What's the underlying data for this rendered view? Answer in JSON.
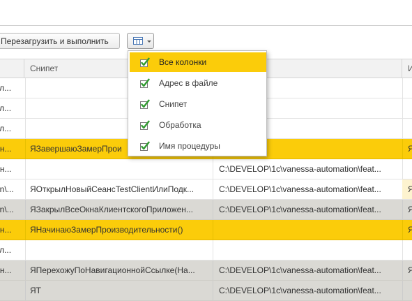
{
  "toolbar": {
    "reload_label": "Перезагрузить и выполнить",
    "columns_button_icon": "grid-icon"
  },
  "table": {
    "headers": [
      "Снипет",
      "И"
    ],
    "rows": [
      {
        "c1": "вл...",
        "snippet": "",
        "path": "",
        "c4": "",
        "style": "normal"
      },
      {
        "c1": "вл...",
        "snippet": "",
        "path": "",
        "c4": "",
        "style": "normal"
      },
      {
        "c1": "вл...",
        "snippet": "",
        "path": "",
        "c4": "",
        "style": "normal"
      },
      {
        "c1": "бн...",
        "snippet": "ЯЗавершаюЗамерПрои",
        "path": "",
        "c4": "Я",
        "style": "hl"
      },
      {
        "c1": "бн...",
        "snippet": "",
        "path": "C:\\DEVELOP\\1c\\vanessa-automation\\feat...",
        "c4": "",
        "style": "normal"
      },
      {
        "c1": "on\\...",
        "snippet": "ЯОткрылНовыйСеансTestClientИлиПодк...",
        "path": "C:\\DEVELOP\\1c\\vanessa-automation\\feat...",
        "c4": "Я",
        "style": "normal"
      },
      {
        "c1": "on\\...",
        "snippet": "ЯЗакрылВсеОкнаКлиентскогоПриложен...",
        "path": "C:\\DEVELOP\\1c\\vanessa-automation\\feat...",
        "c4": "Я",
        "style": "gray"
      },
      {
        "c1": "бн...",
        "snippet": "ЯНачинаюЗамерПроизводительности()",
        "path": "",
        "c4": "Я",
        "style": "hl"
      },
      {
        "c1": "вл...",
        "snippet": "",
        "path": "",
        "c4": "",
        "style": "normal"
      },
      {
        "c1": "бн...",
        "snippet": "ЯПерехожуПоНавигационнойСсылке(На...",
        "path": "C:\\DEVELOP\\1c\\vanessa-automation\\feat...",
        "c4": "Я",
        "style": "gray"
      },
      {
        "c1": "",
        "snippet": "ЯТ",
        "path": "C:\\DEVELOP\\1c\\vanessa-automation\\feat...",
        "c4": "",
        "style": "gray"
      }
    ]
  },
  "columns_menu": {
    "items": [
      {
        "label": "Все колонки",
        "checked": true,
        "active": true
      },
      {
        "label": "Адрес в файле",
        "checked": true,
        "active": false
      },
      {
        "label": "Снипет",
        "checked": true,
        "active": false
      },
      {
        "label": "Обработка",
        "checked": true,
        "active": false
      },
      {
        "label": "Имя процедуры",
        "checked": true,
        "active": false
      }
    ]
  },
  "colors": {
    "highlight": "#fbcc0a",
    "gray_row": "#dad9d4",
    "check_green": "#2f9a2f"
  }
}
